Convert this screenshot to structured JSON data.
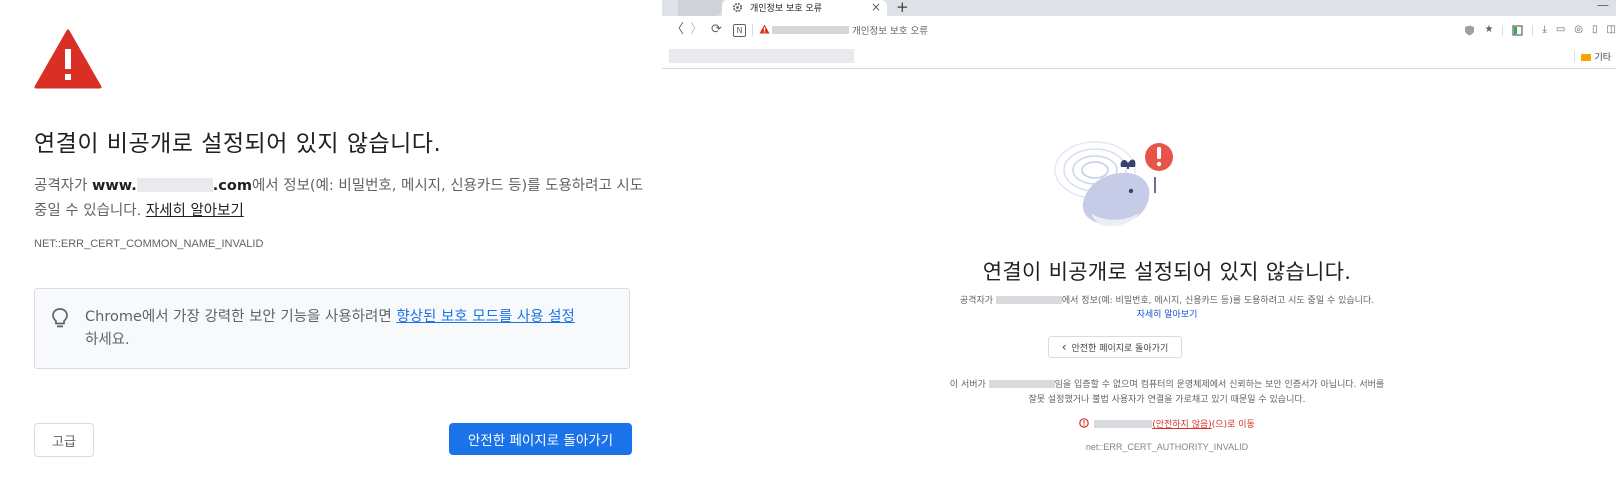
{
  "left": {
    "title": "연결이 비공개로 설정되어 있지 않습니다.",
    "desc_pre": "공격자가 ",
    "desc_domain_prefix": "www.",
    "desc_domain_suffix": ".com",
    "desc_post": "에서 정보(예: 비밀번호, 메시지, 신용카드 등)를 도용하려고 시도 중일 수 있습니다. ",
    "learn_more": "자세히 알아보기",
    "error_code": "NET::ERR_CERT_COMMON_NAME_INVALID",
    "protect_pre": "Chrome에서 가장 강력한 보안 기능을 사용하려면 ",
    "protect_link": "향상된 보호 모드를 사용 설정",
    "protect_post": "하세요.",
    "advanced_button": "고급",
    "back_button": "안전한 페이지로 돌아가기"
  },
  "right": {
    "tab": {
      "title": "개인정보 보호 오류",
      "close": "×",
      "new_tab": "+",
      "minimize": "—"
    },
    "toolbar": {
      "back": "〈",
      "forward": "〉",
      "reload": "⟳",
      "n_badge": "N",
      "url_text": "개인정보 보호 오류",
      "icons": [
        "whale-shield-icon",
        "star-icon",
        "sidebar-icon",
        "download-icon",
        "cast-icon",
        "capture-icon",
        "tab-icon",
        "split-icon"
      ]
    },
    "bookmarks": {
      "folder_label": "기타"
    },
    "title": "연결이 비공개로 설정되어 있지 않습니다.",
    "desc_pre": "공격자가 ",
    "desc_post": "에서 정보(예: 비밀번호, 메시지, 신용카드 등)를 도용하려고 시도 중일 수 있습니다.",
    "learn_more": "자세히 알아보기",
    "back_button": "안전한 페이지로 돌아가기",
    "back_chevron": "‹",
    "info_pre": "이 서버가 ",
    "info_post": "임을 입증할 수 없으며 컴퓨터의 운영체제에서 신뢰하는 보안 인증서가 아닙니다. 서버를",
    "info_line2": "잘못 설정했거나 불법 사용자가 연결을 가로채고 있기 때문일 수 있습니다.",
    "proceed_link": "(안전하지 않음)",
    "proceed_suffix": "(으)로 이동",
    "error_code": "net::ERR_CERT_AUTHORITY_INVALID"
  },
  "colors": {
    "accent_blue": "#1a73e8",
    "warning_red": "#d93025",
    "text_dark": "#202124",
    "text_gray": "#5f6368"
  }
}
